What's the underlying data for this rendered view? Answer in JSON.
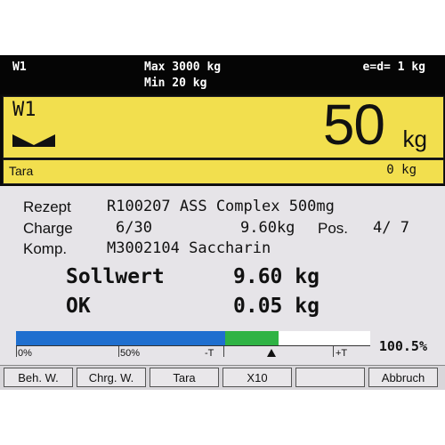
{
  "header": {
    "weigher_id": "W1",
    "capacity_max": "Max 3000 kg",
    "capacity_min": "Min 20 kg",
    "division": "e=d= 1 kg"
  },
  "display": {
    "weigher_id": "W1",
    "weight_value": "50",
    "weight_unit": "kg",
    "tare_label": "Tara",
    "tare_value": "0 kg"
  },
  "recipe": {
    "recipe_label": "Rezept",
    "recipe_value": "R100207 ASS Complex 500mg",
    "charge_label": "Charge",
    "charge_value": "6/30",
    "charge_weight": "9.60kg",
    "pos_label": "Pos.",
    "pos_value": "4/ 7",
    "component_label": "Komp.",
    "component_value": "M3002104 Saccharin"
  },
  "result": {
    "setpoint_label": "Sollwert",
    "setpoint_value": "9.60 kg",
    "status_label": "OK",
    "status_value": "0.05 kg"
  },
  "progress": {
    "percent_text": "100.5%",
    "blue_fraction": 0.59,
    "green_start_fraction": 0.59,
    "green_end_fraction": 0.74,
    "tick_labels": [
      "0%",
      "50%",
      "-T",
      "+T"
    ]
  },
  "softkeys": [
    "Beh. W.",
    "Chrg. W.",
    "Tara",
    "X10",
    "",
    "Abbruch"
  ],
  "colors": {
    "panel_yellow": "#f2df4e",
    "bar_blue": "#1f6fcf",
    "bar_green": "#2fb344"
  }
}
